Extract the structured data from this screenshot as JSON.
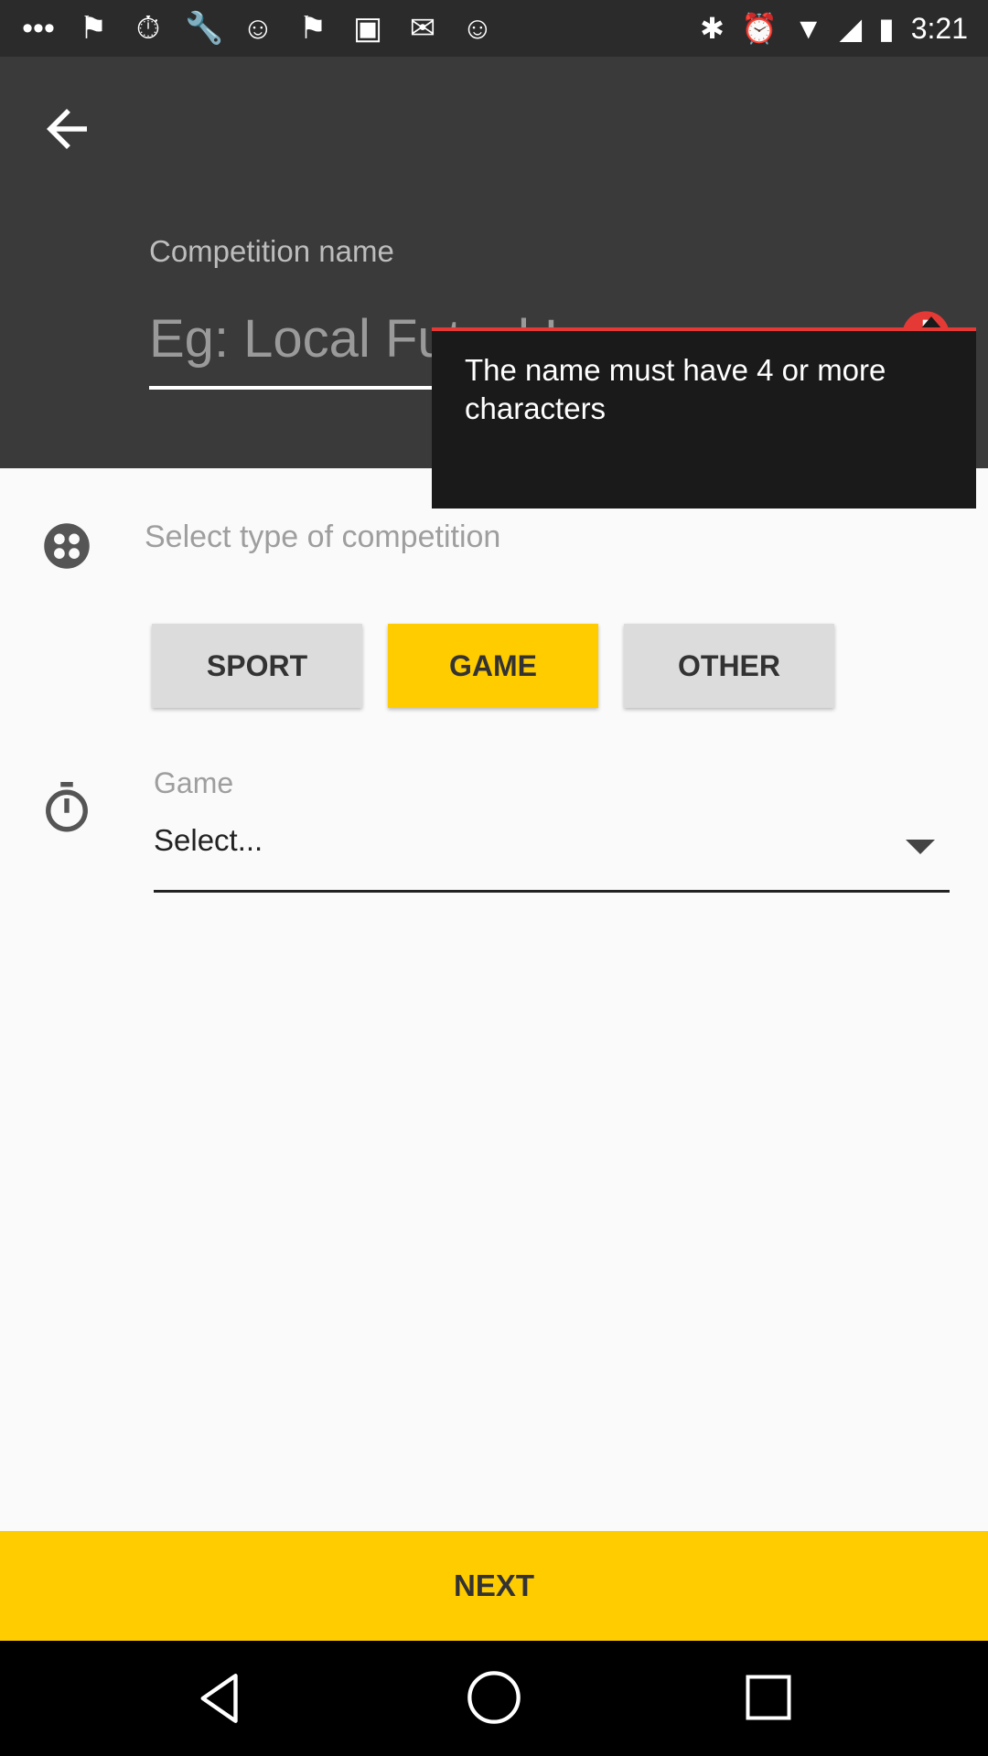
{
  "status_bar": {
    "time": "3:21",
    "left_icons": [
      "more-icon",
      "flag-icon",
      "timer-icon",
      "wrench-icon",
      "smile-icon",
      "flag-icon",
      "qt-icon",
      "chinese-icon",
      "smile-icon",
      "bluetooth-icon",
      "alarm-icon"
    ],
    "right_icons": [
      "bluetooth-icon",
      "alarm-icon",
      "wifi-icon",
      "signal-icon",
      "battery-icon"
    ]
  },
  "header": {
    "back_label": "back",
    "competition_name_label": "Competition name",
    "competition_name_placeholder": "Eg: Local Futsal League",
    "competition_name_value": ""
  },
  "error_tooltip": {
    "message": "The name must have 4 or more characters"
  },
  "type_section": {
    "label": "Select type of competition",
    "options": [
      "SPORT",
      "GAME",
      "OTHER"
    ],
    "selected": "GAME"
  },
  "game_section": {
    "label": "Game",
    "select_value": "Select..."
  },
  "next_label": "NEXT",
  "colors": {
    "accent": "#ffcc00",
    "error": "#e53935",
    "header_bg": "#3a3a3a",
    "status_bg": "#2b2b2b"
  }
}
